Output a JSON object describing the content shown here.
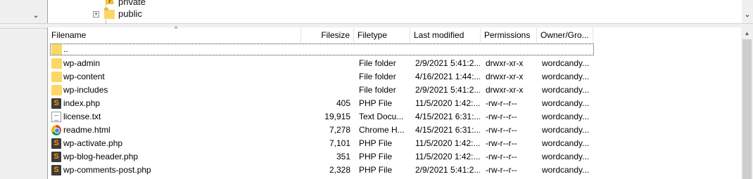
{
  "tree": {
    "items": [
      {
        "label": "private",
        "icon": "warning-folder-icon"
      },
      {
        "label": "public",
        "icon": "folder-icon",
        "expander": "+"
      }
    ],
    "scroll_down_icon": "chevron-down-icon"
  },
  "file_list": {
    "columns": [
      "Filename",
      "Filesize",
      "Filetype",
      "Last modified",
      "Permissions",
      "Owner/Gro..."
    ],
    "sort_indicator": "^",
    "rows": [
      {
        "name": "..",
        "size": "",
        "type": "",
        "modified": "",
        "permissions": "",
        "owner": "",
        "icon": "folder-icon"
      },
      {
        "name": "wp-admin",
        "size": "",
        "type": "File folder",
        "modified": "2/9/2021 5:41:2...",
        "permissions": "drwxr-xr-x",
        "owner": "wordcandy...",
        "icon": "folder-icon"
      },
      {
        "name": "wp-content",
        "size": "",
        "type": "File folder",
        "modified": "4/16/2021 1:44:...",
        "permissions": "drwxr-xr-x",
        "owner": "wordcandy...",
        "icon": "folder-icon"
      },
      {
        "name": "wp-includes",
        "size": "",
        "type": "File folder",
        "modified": "2/9/2021 5:41:2...",
        "permissions": "drwxr-xr-x",
        "owner": "wordcandy...",
        "icon": "folder-icon"
      },
      {
        "name": "index.php",
        "size": "405",
        "type": "PHP File",
        "modified": "11/5/2020 1:42:...",
        "permissions": "-rw-r--r--",
        "owner": "wordcandy...",
        "icon": "php-file-icon"
      },
      {
        "name": "license.txt",
        "size": "19,915",
        "type": "Text Docu...",
        "modified": "4/15/2021 6:31:...",
        "permissions": "-rw-r--r--",
        "owner": "wordcandy...",
        "icon": "text-file-icon"
      },
      {
        "name": "readme.html",
        "size": "7,278",
        "type": "Chrome H...",
        "modified": "4/15/2021 6:31:...",
        "permissions": "-rw-r--r--",
        "owner": "wordcandy...",
        "icon": "chrome-icon"
      },
      {
        "name": "wp-activate.php",
        "size": "7,101",
        "type": "PHP File",
        "modified": "11/5/2020 1:42:...",
        "permissions": "-rw-r--r--",
        "owner": "wordcandy...",
        "icon": "php-file-icon"
      },
      {
        "name": "wp-blog-header.php",
        "size": "351",
        "type": "PHP File",
        "modified": "11/5/2020 1:42:...",
        "permissions": "-rw-r--r--",
        "owner": "wordcandy...",
        "icon": "php-file-icon"
      },
      {
        "name": "wp-comments-post.php",
        "size": "2,328",
        "type": "PHP File",
        "modified": "2/9/2021 5:41:2...",
        "permissions": "-rw-r--r--",
        "owner": "wordcandy...",
        "icon": "php-file-icon"
      }
    ]
  }
}
